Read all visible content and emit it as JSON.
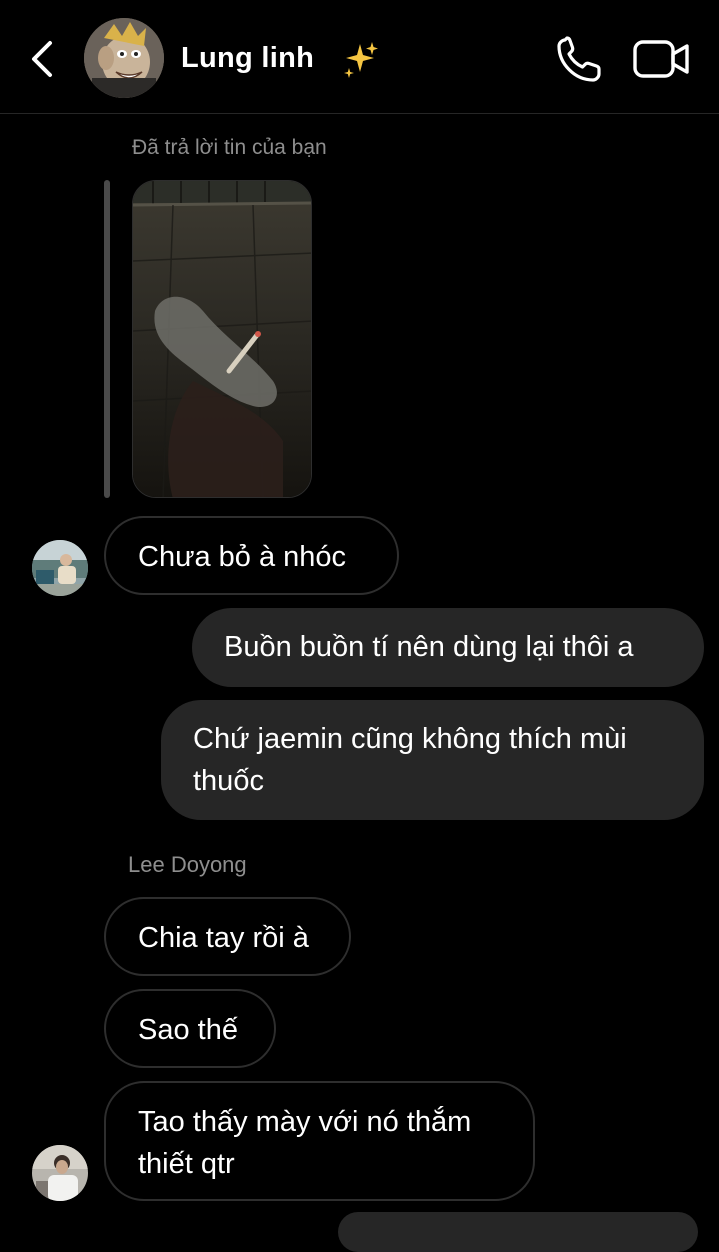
{
  "header": {
    "title": "Lung linh",
    "title_emoji_icon": "sparkles-icon",
    "back_icon": "chevron-left-icon",
    "call_icon": "phone-icon",
    "video_icon": "video-camera-icon"
  },
  "reply": {
    "label": "Đã trả lời tin của bạn",
    "photo_icon": "photo-thumbnail"
  },
  "messages": [
    {
      "direction": "in",
      "text": "Chưa bỏ à nhóc"
    },
    {
      "direction": "out",
      "text": "Buồn buồn tí nên dùng lại thôi a"
    },
    {
      "direction": "out",
      "text": "Chứ jaemin cũng không thích mùi thuốc"
    },
    {
      "direction": "in",
      "sender": "Lee Doyong",
      "text": "Chia tay rồi à"
    },
    {
      "direction": "in",
      "text": "Sao thế"
    },
    {
      "direction": "in",
      "text": "Tao thấy mày với nó thắm thiết qtr"
    }
  ],
  "colors": {
    "background": "#000000",
    "outgoing_bubble": "#262626",
    "incoming_border": "#2e2e2e",
    "secondary_text": "#8e8e8e"
  }
}
